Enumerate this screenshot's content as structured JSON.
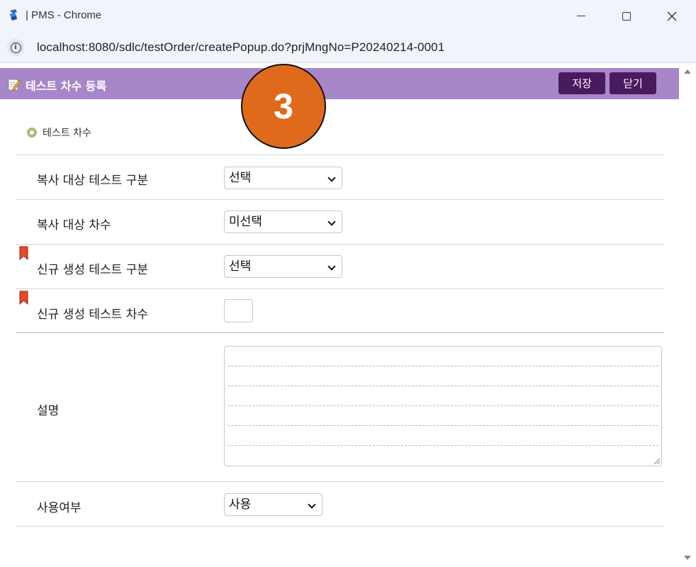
{
  "window": {
    "title": "| PMS - Chrome",
    "url": "localhost:8080/sdlc/testOrder/createPopup.do?prjMngNo=P20240214-0001"
  },
  "header": {
    "title": "테스트 차수 등록",
    "save_label": "저장",
    "close_label": "닫기",
    "bg_color": "#a786c9",
    "button_color": "#4a1a5e"
  },
  "badge": {
    "number": "3",
    "color": "#e06a1b"
  },
  "section": {
    "title": "테스트 차수"
  },
  "form": {
    "copy_target_type": {
      "label": "복사 대상 테스트 구분",
      "value": "선택"
    },
    "copy_target_round": {
      "label": "복사 대상 차수",
      "value": "미선택"
    },
    "new_test_type": {
      "label": "신규 생성 테스트 구분",
      "value": "선택",
      "required": true
    },
    "new_test_round": {
      "label": "신규 생성 테스트 차수",
      "value": "",
      "required": true
    },
    "description": {
      "label": "설명",
      "value": ""
    },
    "use_yn": {
      "label": "사용여부",
      "value": "사용"
    }
  }
}
